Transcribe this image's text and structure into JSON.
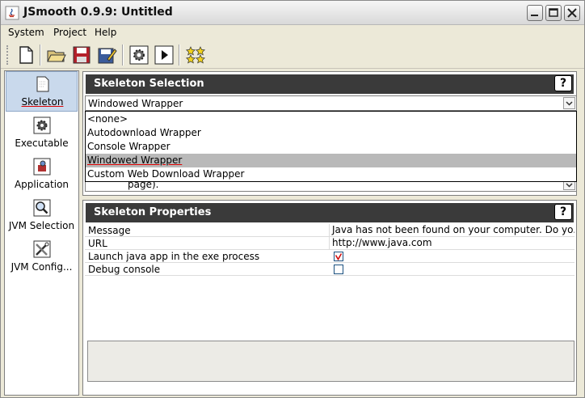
{
  "window": {
    "title": "JSmooth 0.9.9: Untitled"
  },
  "menu": [
    {
      "label": "System"
    },
    {
      "label": "Project"
    },
    {
      "label": "Help"
    }
  ],
  "toolbar": {
    "buttons": [
      {
        "name": "new-icon"
      },
      {
        "name": "open-folder-icon"
      },
      {
        "name": "save-icon"
      },
      {
        "name": "save-as-icon"
      },
      {
        "name": "compile-gear-icon"
      },
      {
        "name": "run-icon"
      },
      {
        "name": "about-stars-icon"
      }
    ]
  },
  "sidebar": {
    "items": [
      {
        "label": "Skeleton",
        "icon": "skeleton-icon",
        "selected": true
      },
      {
        "label": "Executable",
        "icon": "executable-gear-icon"
      },
      {
        "label": "Application",
        "icon": "application-icon"
      },
      {
        "label": "JVM Selection",
        "icon": "jvm-search-icon"
      },
      {
        "label": "JVM Config...",
        "icon": "jvm-config-tools-icon"
      }
    ]
  },
  "skeleton_selection": {
    "title": "Skeleton Selection",
    "help": "?",
    "selected_value": "Windowed Wrapper",
    "options": [
      {
        "label": "<none>"
      },
      {
        "label": "Autodownload Wrapper"
      },
      {
        "label": "Console Wrapper"
      },
      {
        "label": "Windowed Wrapper",
        "selected": true
      },
      {
        "label": "Custom Web Download Wrapper"
      }
    ],
    "description_fragment": "page)."
  },
  "skeleton_properties": {
    "title": "Skeleton Properties",
    "help": "?",
    "rows": [
      {
        "name": "Message",
        "value": "Java has not been found on your computer. Do yo..."
      },
      {
        "name": "URL",
        "value": "http://www.java.com"
      },
      {
        "name": "Launch java app in the exe process",
        "checked": true
      },
      {
        "name": "Debug console",
        "checked": false
      }
    ]
  },
  "colors": {
    "panel_header": "#3a3a3a",
    "selection": "#b9b9b9",
    "accent_underline": "#dd0000"
  }
}
